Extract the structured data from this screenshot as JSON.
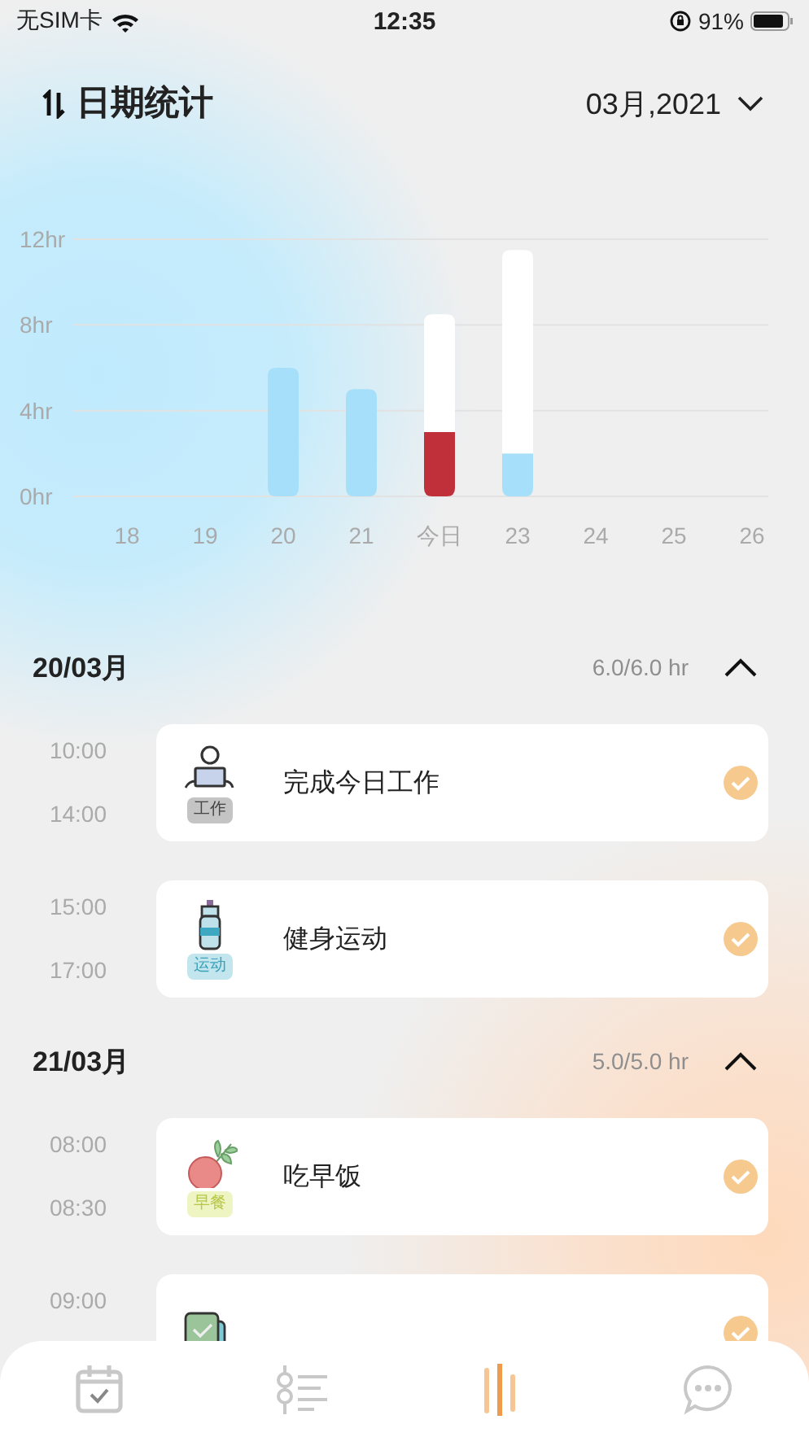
{
  "status_bar": {
    "carrier": "无SIM卡",
    "time": "12:35",
    "battery": "91%"
  },
  "header": {
    "title": "日期统计",
    "month_picker": "03月,2021"
  },
  "chart_data": {
    "type": "bar",
    "categories": [
      "18",
      "19",
      "20",
      "21",
      "今日",
      "23",
      "24",
      "25",
      "26"
    ],
    "stacked": true,
    "ylim": [
      0,
      12
    ],
    "yticks": [
      {
        "value": 0,
        "label": "0hr"
      },
      {
        "value": 4,
        "label": "4hr"
      },
      {
        "value": 8,
        "label": "8hr"
      },
      {
        "value": 12,
        "label": "12hr"
      }
    ],
    "series": [
      {
        "color": "#a6dff9",
        "values": [
          null,
          null,
          6,
          5,
          null,
          2,
          null,
          null,
          null
        ]
      },
      {
        "color": "#c0303a",
        "values": [
          null,
          null,
          null,
          null,
          3,
          null,
          null,
          null,
          null
        ]
      },
      {
        "color": "#ffffff",
        "values": [
          null,
          null,
          null,
          null,
          5.5,
          9.5,
          null,
          null,
          null
        ]
      }
    ]
  },
  "days": [
    {
      "date": "20/03月",
      "total": "6.0/6.0 hr",
      "expanded": true,
      "items": [
        {
          "start": "10:00",
          "end": "14:00",
          "title": "完成今日工作",
          "kind": "work",
          "tag": "工作",
          "color": "#c4c4c4",
          "done": true
        },
        {
          "start": "15:00",
          "end": "17:00",
          "title": "健身运动",
          "kind": "bottle",
          "tag": "运动",
          "color": "#c3e6ee",
          "done": true
        }
      ]
    },
    {
      "date": "21/03月",
      "total": "5.0/5.0 hr",
      "expanded": true,
      "items": [
        {
          "start": "08:00",
          "end": "08:30",
          "title": "吃早饭",
          "kind": "radish",
          "tag": "早餐",
          "color": "#eef4c2",
          "done": true
        },
        {
          "start": "09:00",
          "kind": "checkin",
          "done": true
        }
      ]
    }
  ],
  "tabs": [
    {
      "kind": "calendar",
      "selected": false
    },
    {
      "kind": "list",
      "selected": false
    },
    {
      "kind": "stats",
      "selected": true
    },
    {
      "kind": "chat",
      "selected": false
    }
  ]
}
